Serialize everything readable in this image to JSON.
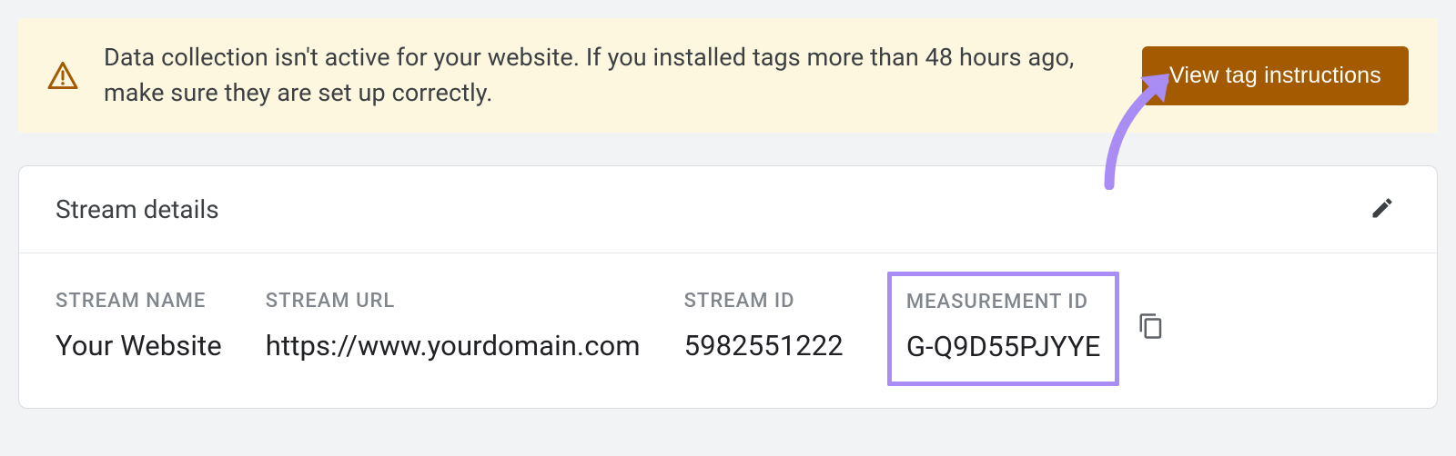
{
  "banner": {
    "message": "Data collection isn't active for your website. If you installed tags more than 48 hours ago, make sure they are set up correctly.",
    "button_label": "View tag instructions"
  },
  "card": {
    "title": "Stream details",
    "fields": {
      "stream_name": {
        "label": "STREAM NAME",
        "value": "Your Website"
      },
      "stream_url": {
        "label": "STREAM URL",
        "value": "https://www.yourdomain.com"
      },
      "stream_id": {
        "label": "STREAM ID",
        "value": "5982551222"
      },
      "measurement_id": {
        "label": "MEASUREMENT ID",
        "value": "G-Q9D55PJYYE"
      }
    }
  }
}
